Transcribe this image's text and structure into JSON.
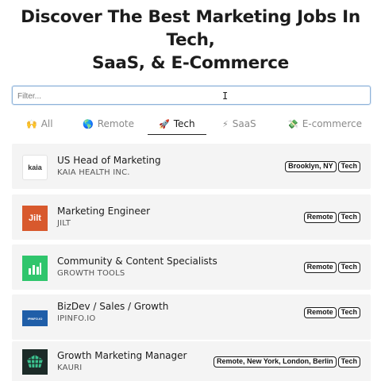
{
  "page": {
    "headline_line1": "Discover The Best Marketing Jobs In Tech,",
    "headline_line2": "SaaS, & E-Commerce"
  },
  "filter": {
    "placeholder": "Filter...",
    "value": ""
  },
  "tabs": [
    {
      "emoji": "🙌",
      "label": "All",
      "active": false
    },
    {
      "emoji": "🌎",
      "label": "Remote",
      "active": false
    },
    {
      "emoji": "🚀",
      "label": "Tech",
      "active": true
    },
    {
      "emoji": "⚡",
      "label": "SaaS",
      "active": false
    },
    {
      "emoji": "💸",
      "label": "E-commerce",
      "active": false
    }
  ],
  "jobs": [
    {
      "title": "US Head of Marketing",
      "company": "KAIA HEALTH INC.",
      "logo_text": "kaia",
      "logo_icon": "kaia-logo",
      "tags": [
        "Brooklyn, NY",
        "Tech"
      ]
    },
    {
      "title": "Marketing Engineer",
      "company": "JILT",
      "logo_text": "Jilt",
      "logo_icon": "jilt-logo",
      "tags": [
        "Remote",
        "Tech"
      ]
    },
    {
      "title": "Community & Content Specialists",
      "company": "GROWTH TOOLS",
      "logo_text": "",
      "logo_icon": "bar-chart-logo",
      "tags": [
        "Remote",
        "Tech"
      ]
    },
    {
      "title": "BizDev / Sales / Growth",
      "company": "IPINFO.IO",
      "logo_text": "IPINFO.IO",
      "logo_icon": "ipinfo-logo",
      "tags": [
        "Remote",
        "Tech"
      ]
    },
    {
      "title": "Growth Marketing Manager",
      "company": "KAURI",
      "logo_text": "",
      "logo_icon": "kauri-shell-logo",
      "tags": [
        "Remote, New York, London, Berlin",
        "Tech"
      ]
    }
  ],
  "colors": {
    "row_bg": "#f4f4f4",
    "jilt_orange": "#d8592d",
    "growth_green": "#2fc56c",
    "ipinfo_blue": "#1f5ea8",
    "kauri_dark": "#1c2b28",
    "kauri_green": "#3cc28f"
  }
}
